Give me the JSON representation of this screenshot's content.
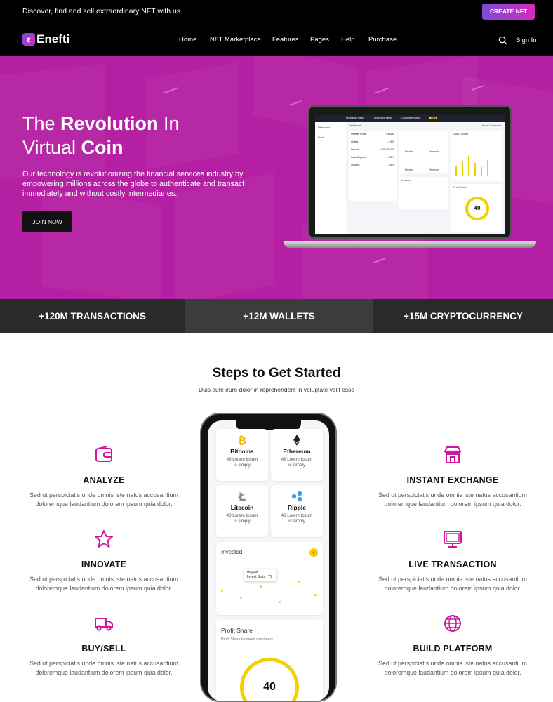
{
  "topbar": {
    "message": "Discover, find and sell extraordinary NFT with us.",
    "cta": "CREATE NFT"
  },
  "nav": {
    "logo": "Enefti",
    "logo_mark": "ε",
    "items": [
      "Home",
      "NFT Marketplace",
      "Features",
      "Pages",
      "Help",
      "Purchase"
    ],
    "signin": "Sign In"
  },
  "hero": {
    "title_pre": "The ",
    "title_bold1": "Revolution",
    "title_mid": " In",
    "title_line2_pre": "Virtual ",
    "title_bold2": "Coin",
    "description": "Our technology is revolutionizing the financial services industry by empowering millions across the globe to authenticate and transact immediately and without costly intermediaries.",
    "button": "JOIN NOW"
  },
  "laptop_dashboard": {
    "top_tabs": [
      "Dropdown Menu",
      "Dropdown Menu",
      "Dropdown Menu",
      "New"
    ],
    "sidebar": [
      "Dashboard",
      "Blank"
    ],
    "heading": "Dashboard",
    "crumb": "Home / Dashboard",
    "rows": [
      {
        "label": "Member Profit",
        "value": "+ $1480"
      },
      {
        "label": "Orders",
        "value": "- 2,500"
      },
      {
        "label": "Deposit",
        "value": "+ 20,000,000"
      },
      {
        "label": "Issue Reports",
        "value": "- 78 %"
      },
      {
        "label": "Invoices",
        "value": "- 78 %"
      }
    ],
    "coins": [
      "Bitcoins",
      "Ethereum",
      "Bitcoins",
      "Ethereum"
    ],
    "daily_deposit": "Daily Deposit",
    "invested": "Invested",
    "profit_share": "Profit Share",
    "gauge": "40"
  },
  "stats": [
    "+120M TRANSACTIONS",
    "+12M WALLETS",
    "+15M CRYPTOCURRENCY"
  ],
  "steps": {
    "title": "Steps to Get Started",
    "subtitle": "Duis aute irure dolor in reprehenderit in voluptate velit esse"
  },
  "features": [
    {
      "title": "ANALYZE",
      "desc": "Sed ut perspiciatis unde omnis iste natus accusantium doloremque laudantium dolorem ipsum quia dolor.",
      "icon": "wallet-icon"
    },
    {
      "title": "INNOVATE",
      "desc": "Sed ut perspiciatis unde omnis iste natus accusantium doloremque laudantium dolorem ipsum quia dolor.",
      "icon": "star-icon"
    },
    {
      "title": "BUY/SELL",
      "desc": "Sed ut perspiciatis unde omnis iste natus accusantium doloremque laudantium dolorem ipsum quia dolor.",
      "icon": "truck-icon"
    },
    {
      "title": "INSTANT EXCHANGE",
      "desc": "Sed ut perspiciatis unde omnis iste natus accusantium doloremque laudantium dolorem ipsum quia dolor.",
      "icon": "store-icon"
    },
    {
      "title": "LIVE TRANSACTION",
      "desc": "Sed ut perspiciatis unde omnis iste natus accusantium doloremque laudantium dolorem ipsum quia dolor.",
      "icon": "monitor-icon"
    },
    {
      "title": "BUILD PLATFORM",
      "desc": "Sed ut perspiciatis unde omnis iste natus accusantium doloremque laudantium dolorem ipsum quia dolor.",
      "icon": "globe-icon"
    }
  ],
  "phone": {
    "coins": [
      {
        "name": "Bitcoins",
        "desc": "48 Lorem Ipsum is simply"
      },
      {
        "name": "Ethereum",
        "desc": "48 Lorem Ipsum is simply"
      },
      {
        "name": "Litecoin",
        "desc": "48 Lorem Ipsum is simply"
      },
      {
        "name": "Ripple",
        "desc": "48 Lorem Ipsum is simply"
      }
    ],
    "invested": "Invested",
    "tooltip_month": "August",
    "tooltip_value": "Invest Stats : 79",
    "profit_title": "Profit Share",
    "profit_sub": "Profit Share between customers",
    "gauge": "40"
  },
  "colors": {
    "brand": "#b41fa4",
    "accent": "#d1159e",
    "yellow": "#f5d000"
  }
}
